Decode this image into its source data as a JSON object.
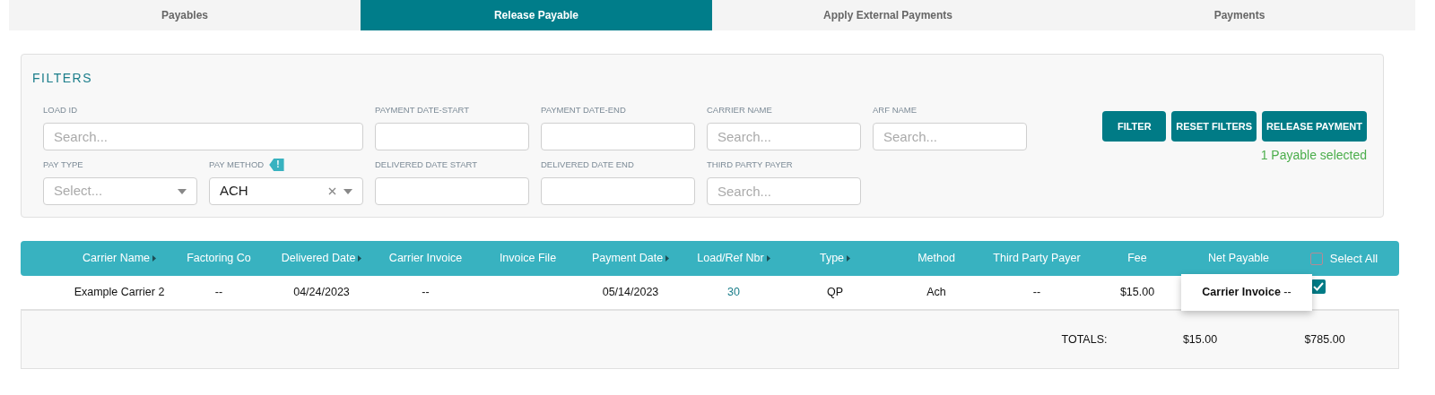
{
  "tabs": [
    {
      "label": "Payables",
      "selected": false
    },
    {
      "label": "Release Payable",
      "selected": true
    },
    {
      "label": "Apply External Payments",
      "selected": false
    },
    {
      "label": "Payments",
      "selected": false
    }
  ],
  "filters": {
    "title": "FILTERS",
    "fields": [
      {
        "kind": "text",
        "label": "LOAD ID",
        "placeholder": "Search...",
        "wide": true
      },
      {
        "kind": "text",
        "label": "PAYMENT DATE-START"
      },
      {
        "kind": "text",
        "label": "PAYMENT DATE-END"
      },
      {
        "kind": "text",
        "label": "CARRIER NAME",
        "placeholder": "Search..."
      },
      {
        "kind": "text",
        "label": "ARF NAME",
        "placeholder": "Search..."
      },
      {
        "kind": "select",
        "label": "PAY TYPE",
        "placeholder": "Select..."
      },
      {
        "kind": "select",
        "label": "PAY METHOD",
        "value": "ACH",
        "badge": "!",
        "clearable": true
      },
      {
        "kind": "text",
        "label": "DELIVERED DATE START"
      },
      {
        "kind": "text",
        "label": "DELIVERED DATE END"
      },
      {
        "kind": "text",
        "label": "THIRD PARTY PAYER",
        "placeholder": "Search..."
      }
    ],
    "buttons": [
      "FILTER",
      "RESET FILTERS",
      "RELEASE PAYMENT"
    ],
    "selection_note": "1 Payable selected"
  },
  "table": {
    "columns": [
      {
        "label": "Carrier Name",
        "sortable": true
      },
      {
        "label": "Factoring Co",
        "sortable": false
      },
      {
        "label": "Delivered Date",
        "sortable": true
      },
      {
        "label": "Carrier Invoice",
        "sortable": false
      },
      {
        "label": "Invoice File",
        "sortable": false
      },
      {
        "label": "Payment Date",
        "sortable": true
      },
      {
        "label": "Load/Ref Nbr",
        "sortable": true
      },
      {
        "label": "Type",
        "sortable": true
      },
      {
        "label": "Method",
        "sortable": false
      },
      {
        "label": "Third Party Payer",
        "sortable": false
      },
      {
        "label": "Fee",
        "sortable": false
      },
      {
        "label": "Net Payable",
        "sortable": false
      }
    ],
    "select_all": {
      "label": "Select All",
      "checked": false
    },
    "rows": [
      {
        "selected": true,
        "cells": [
          {
            "kind": "text",
            "text": "Example Carrier 2"
          },
          {
            "kind": "text",
            "text": "--"
          },
          {
            "kind": "text",
            "text": "04/24/2023"
          },
          {
            "kind": "text",
            "text": "--"
          },
          {
            "kind": "text",
            "text": ""
          },
          {
            "kind": "text",
            "text": "05/14/2023"
          },
          {
            "kind": "link",
            "text": "30"
          },
          {
            "kind": "text",
            "text": "QP"
          },
          {
            "kind": "text",
            "text": "Ach"
          },
          {
            "kind": "text",
            "text": "--"
          },
          {
            "kind": "text",
            "text": "$15.00"
          }
        ],
        "tooltip": "**Carrier Invoice** --"
      }
    ],
    "totals": {
      "label": "TOTALS:",
      "fee": "$15.00",
      "net_payable": "$785.00"
    }
  }
}
